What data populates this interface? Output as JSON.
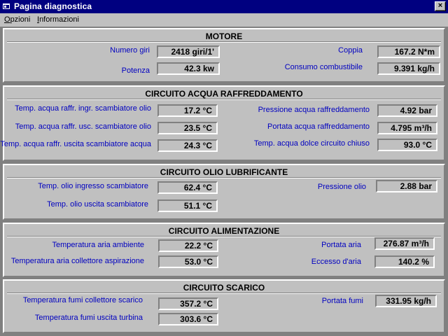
{
  "window": {
    "title": "Pagina diagnostica",
    "close_glyph": "×"
  },
  "menu": {
    "items": [
      {
        "u": "O",
        "rest": "pzioni"
      },
      {
        "u": "I",
        "rest": "nformazioni"
      }
    ]
  },
  "sections": {
    "motore": {
      "title": "MOTORE",
      "fields": [
        {
          "label": "Numero giri",
          "value": "2418 giri/1'"
        },
        {
          "label": "Potenza",
          "value": "42.3 kw"
        },
        {
          "label": "Coppia",
          "value": "167.2 N*m"
        },
        {
          "label": "Consumo combustibile",
          "value": "9.391 kg/h"
        }
      ]
    },
    "acqua": {
      "title": "CIRCUITO ACQUA RAFFREDDAMENTO",
      "fields": [
        {
          "label": "Temp. acqua raffr. ingr. scambiatore olio",
          "value": "17.2 °C"
        },
        {
          "label": "Temp. acqua raffr. usc. scambiatore olio",
          "value": "23.5 °C"
        },
        {
          "label": "Temp. acqua raffr. uscita scambiatore acqua",
          "value": "24.3 °C"
        },
        {
          "label": "Pressione acqua raffreddamento",
          "value": "4.92 bar"
        },
        {
          "label": "Portata acqua raffreddamento",
          "value": "4.795 m³/h"
        },
        {
          "label": "Temp. acqua dolce circuito chiuso",
          "value": "93.0 °C"
        }
      ]
    },
    "olio": {
      "title": "CIRCUITO OLIO LUBRIFICANTE",
      "fields": [
        {
          "label": "Temp. olio ingresso scambiatore",
          "value": "62.4 °C"
        },
        {
          "label": "Temp. olio uscita scambiatore",
          "value": "51.1 °C"
        },
        {
          "label": "Pressione olio",
          "value": "2.88 bar"
        }
      ]
    },
    "alimentazione": {
      "title": "CIRCUITO ALIMENTAZIONE",
      "fields": [
        {
          "label": "Temperatura aria ambiente",
          "value": "22.2 °C"
        },
        {
          "label": "Temperatura aria collettore aspirazione",
          "value": "53.0 °C"
        },
        {
          "label": "Portata aria",
          "value": "276.87 m³/h"
        },
        {
          "label": "Eccesso d'aria",
          "value": "140.2 %"
        }
      ]
    },
    "scarico": {
      "title": "CIRCUITO SCARICO",
      "fields": [
        {
          "label": "Temperatura fumi collettore scarico",
          "value": "357.2 °C"
        },
        {
          "label": "Temperatura fumi uscita turbina",
          "value": "303.6 °C"
        },
        {
          "label": "Portata fumi",
          "value": "331.95 kg/h"
        }
      ]
    }
  }
}
